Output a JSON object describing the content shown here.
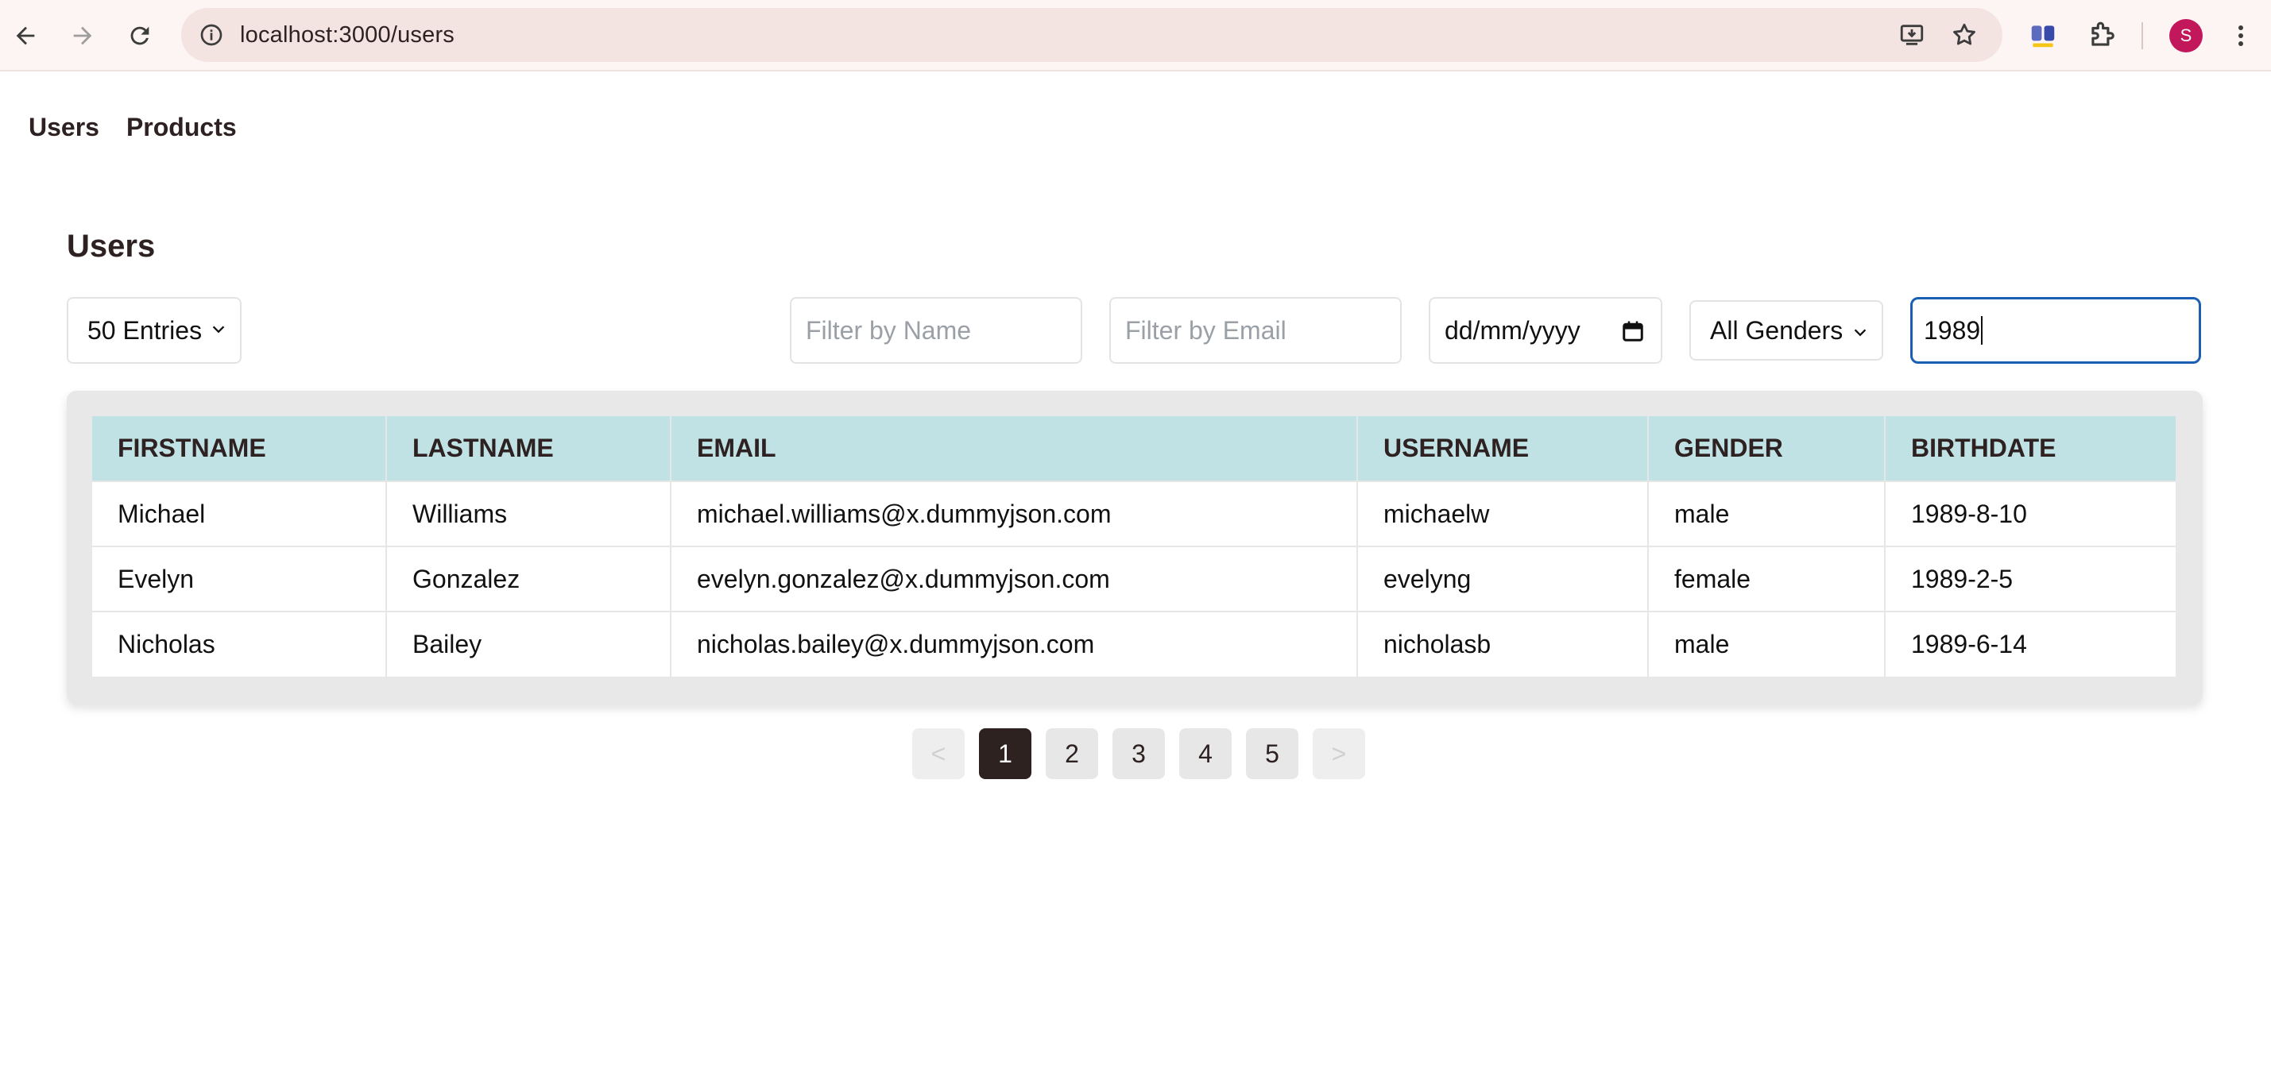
{
  "browser": {
    "url": "localhost:3000/users",
    "avatar_letter": "S",
    "icons": [
      "back-icon",
      "forward-icon",
      "reload-icon",
      "site-info-icon",
      "install-app-icon",
      "bookmark-star-icon",
      "extension-app-icon",
      "puzzle-extensions-icon",
      "profile-avatar",
      "kebab-menu-icon"
    ]
  },
  "nav": {
    "users": "Users",
    "products": "Products"
  },
  "page": {
    "title": "Users"
  },
  "filters": {
    "entries_selected": "50 Entries",
    "name_placeholder": "Filter by Name",
    "email_placeholder": "Filter by Email",
    "date_placeholder": "dd/mm/yyyy",
    "gender_selected": "All Genders",
    "search_value": "1989"
  },
  "table": {
    "headers": [
      "FIRSTNAME",
      "LASTNAME",
      "EMAIL",
      "USERNAME",
      "GENDER",
      "BIRTHDATE"
    ],
    "rows": [
      [
        "Michael",
        "Williams",
        "michael.williams@x.dummyjson.com",
        "michaelw",
        "male",
        "1989-8-10"
      ],
      [
        "Evelyn",
        "Gonzalez",
        "evelyn.gonzalez@x.dummyjson.com",
        "evelyng",
        "female",
        "1989-2-5"
      ],
      [
        "Nicholas",
        "Bailey",
        "nicholas.bailey@x.dummyjson.com",
        "nicholasb",
        "male",
        "1989-6-14"
      ]
    ]
  },
  "pagination": {
    "prev": "<",
    "pages": [
      "1",
      "2",
      "3",
      "4",
      "5"
    ],
    "next": ">",
    "current": "1"
  },
  "colors": {
    "header_bg": "#c1e2e5",
    "active_page_bg": "#2e2220",
    "focus_border": "#1a5fb4",
    "avatar_bg": "#c2185b"
  }
}
